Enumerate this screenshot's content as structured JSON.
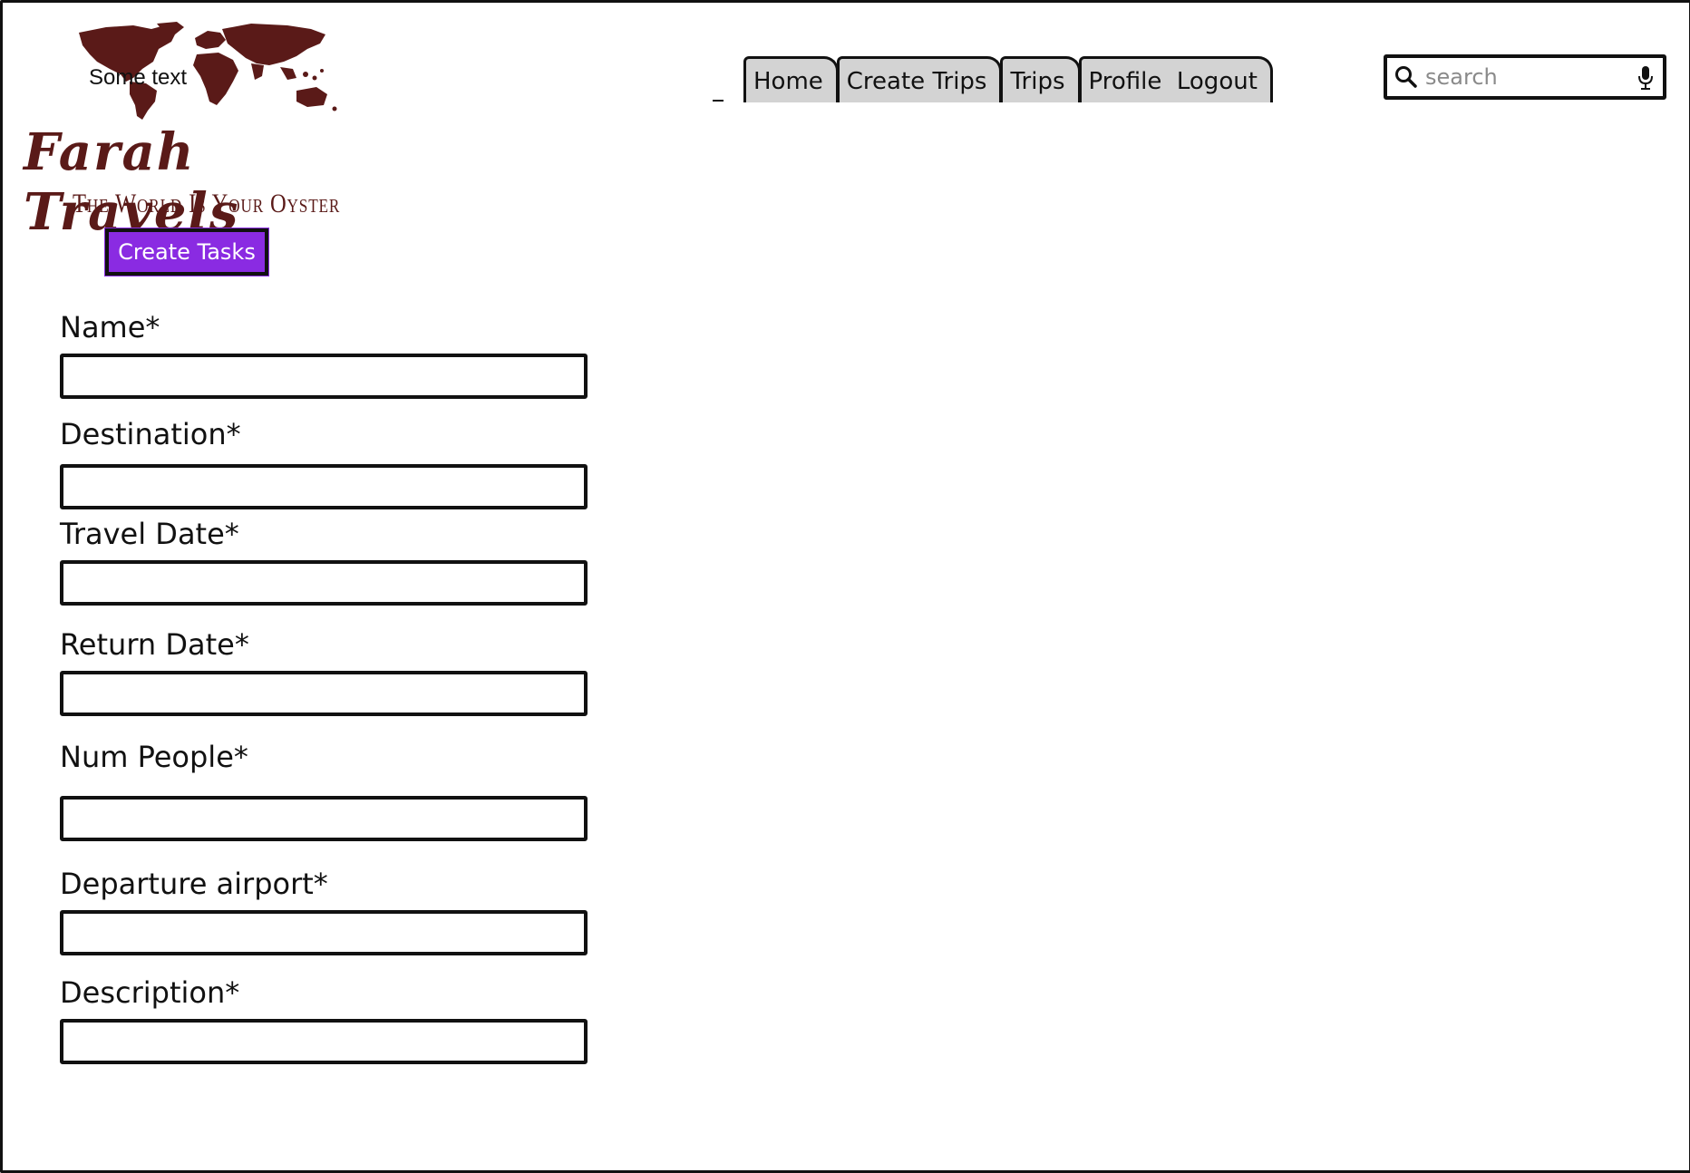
{
  "logo": {
    "overlay_text": "Some text",
    "brand": "Farah Travels",
    "tagline": "The World Is Your Oyster",
    "color": "#5a1a18"
  },
  "nav": {
    "tabs": [
      {
        "label": "Home"
      },
      {
        "label": "Create Trips"
      },
      {
        "label": "Trips"
      },
      {
        "label": "Profile  Logout"
      }
    ]
  },
  "search": {
    "placeholder": "search",
    "icon": "search-icon",
    "mic_icon": "microphone-icon"
  },
  "action": {
    "create_label": "Create Tasks",
    "accent": "#8a2be2"
  },
  "form": {
    "fields": [
      {
        "label": "Name*",
        "value": ""
      },
      {
        "label": "Destination*",
        "value": ""
      },
      {
        "label": "Travel Date*",
        "value": ""
      },
      {
        "label": "Return Date*",
        "value": ""
      },
      {
        "label": "Num People*",
        "value": ""
      },
      {
        "label": "Departure airport*",
        "value": ""
      },
      {
        "label": "Description*",
        "value": ""
      }
    ]
  }
}
